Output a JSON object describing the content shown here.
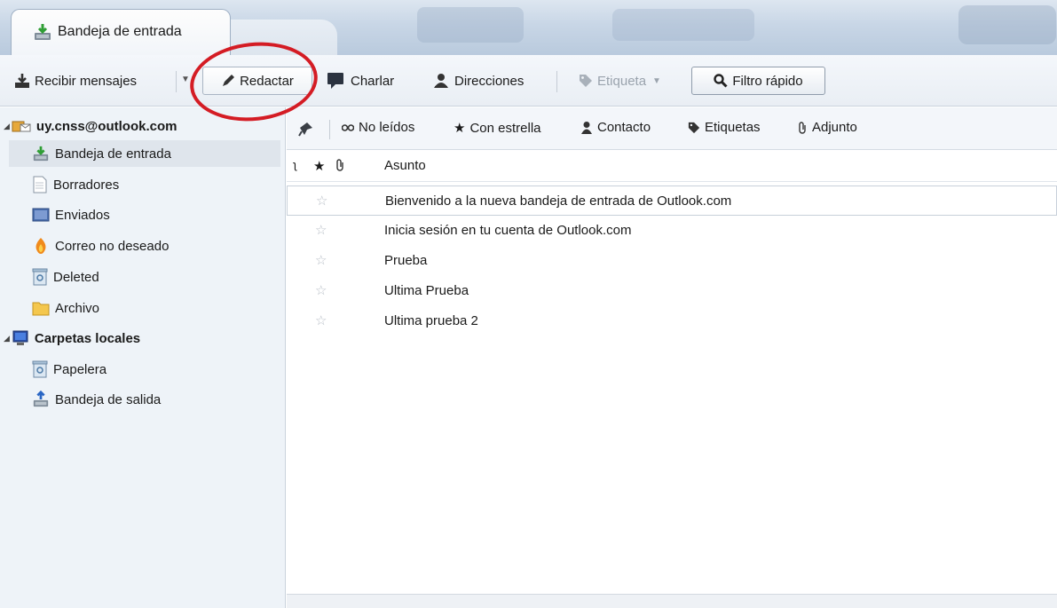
{
  "tab": {
    "label": "Bandeja de entrada"
  },
  "toolbar": {
    "recibir": "Recibir mensajes",
    "redactar": "Redactar",
    "charlar": "Charlar",
    "direcciones": "Direcciones",
    "etiqueta": "Etiqueta",
    "filtro": "Filtro rápido"
  },
  "sidebar": {
    "account": "uy.cnss@outlook.com",
    "account_folders": [
      "Bandeja de entrada",
      "Borradores",
      "Enviados",
      "Correo no deseado",
      "Deleted",
      "Archivo"
    ],
    "local": "Carpetas locales",
    "local_folders": [
      "Papelera",
      "Bandeja de salida"
    ]
  },
  "filterbar": {
    "no_leidos": "No leídos",
    "con_estrella": "Con estrella",
    "contacto": "Contacto",
    "etiquetas": "Etiquetas",
    "adjunto": "Adjunto"
  },
  "list": {
    "col_subject": "Asunto",
    "rows": [
      "Bienvenido a la nueva bandeja de entrada de Outlook.com",
      "Inicia sesión en tu cuenta de Outlook.com",
      "Prueba",
      "Ultima Prueba",
      "Ultima prueba 2"
    ]
  },
  "colors": {
    "annotation": "#d41c24",
    "sidebar_bg": "#eef3f8",
    "toolbar_bg": "#eef2f6"
  },
  "icons": [
    "inbox-icon",
    "get-mail-icon",
    "pencil-icon",
    "chat-icon",
    "address-book-icon",
    "tag-icon",
    "search-icon",
    "pin-icon",
    "star-icon",
    "contact-icon",
    "paperclip-icon",
    "drafts-icon",
    "sent-icon",
    "junk-icon",
    "trash-icon",
    "archive-icon",
    "computer-icon",
    "outbox-icon"
  ]
}
